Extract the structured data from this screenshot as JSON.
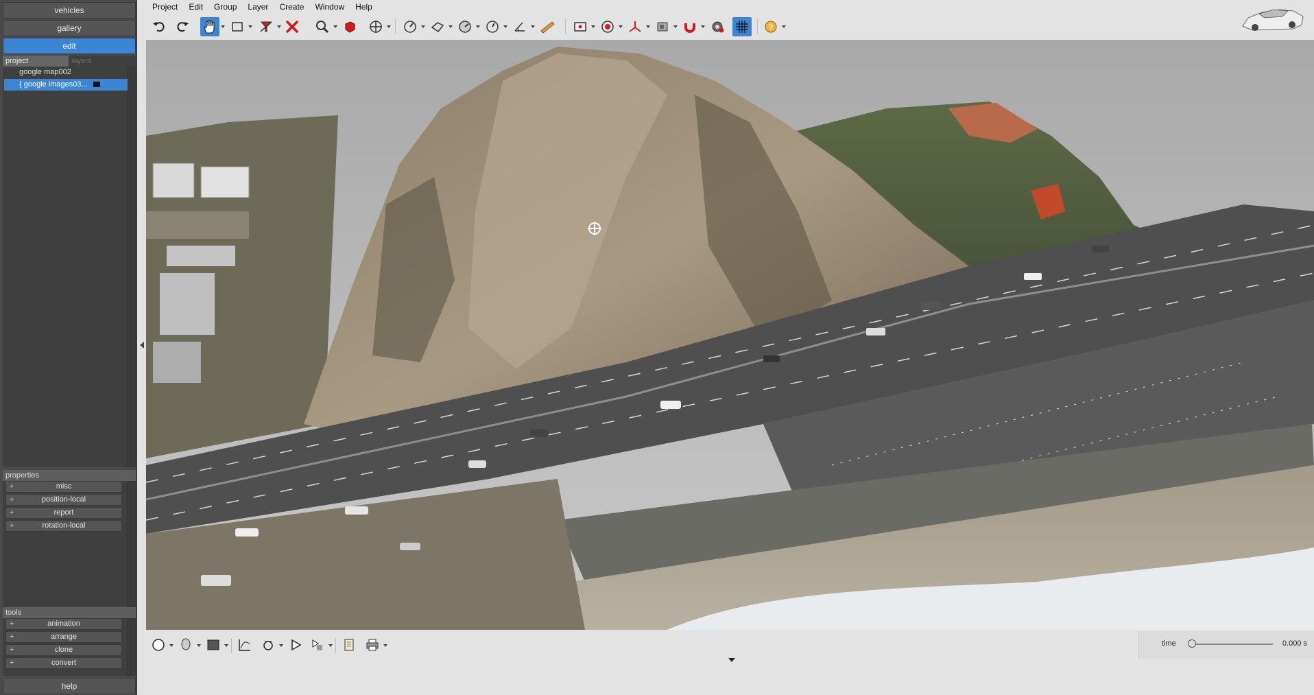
{
  "nav": {
    "vehicles": "vehicles",
    "gallery": "gallery",
    "edit": "edit",
    "help": "help"
  },
  "project_panel": {
    "tab_project": "project",
    "tab_layers": "layers",
    "items": [
      {
        "label": "google map002"
      },
      {
        "label": "{ google images03..."
      }
    ]
  },
  "properties": {
    "header": "properties",
    "items": [
      "misc",
      "position-local",
      "report",
      "rotation-local"
    ]
  },
  "tools": {
    "header": "tools",
    "items": [
      "animation",
      "arrange",
      "clone",
      "convert"
    ]
  },
  "menu": [
    "Project",
    "Edit",
    "Group",
    "Layer",
    "Create",
    "Window",
    "Help"
  ],
  "toolbar_icons": [
    "undo-icon",
    "redo-icon",
    "pan-hand-icon",
    "select-rectangle-icon",
    "filter-icon",
    "delete-icon",
    "zoom-icon",
    "cube-icon",
    "move-icon",
    "measure-icon",
    "polygon-icon",
    "gauge-icon",
    "clock-icon",
    "angle-icon",
    "ruler-icon",
    "camera-icon",
    "target-icon",
    "axis-icon",
    "render-icon",
    "magnet-icon",
    "settings-icon",
    "grid-icon",
    "help-icon"
  ],
  "timeline": {
    "label": "time",
    "value": "0.000 s",
    "position": 0
  },
  "colors": {
    "accent": "#3c85d2",
    "panel": "#4a4a4a",
    "toolbar": "#e3e3e3"
  }
}
